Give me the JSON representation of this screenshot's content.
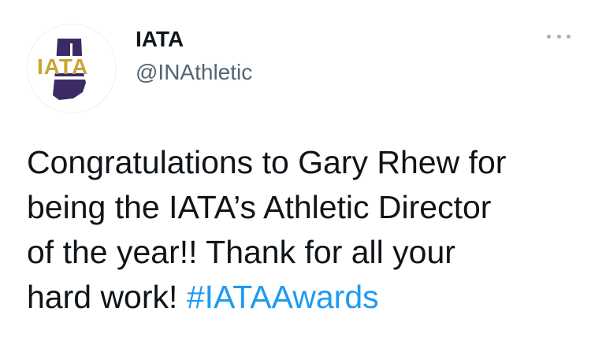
{
  "author": {
    "display_name": "IATA",
    "handle": "@INAthletic",
    "avatar_text": "IATA"
  },
  "tweet": {
    "lines": [
      "Congratulations to Gary Rhew for",
      "being the IATA’s Athletic Director",
      "of the year!! Thank for all your",
      "hard work! "
    ],
    "hashtag": "#IATAAwards"
  },
  "colors": {
    "text": "#0f1419",
    "handle": "#536471",
    "link": "#1d9bf0",
    "logo_gold": "#c7a536",
    "logo_purple": "#3b2a63"
  },
  "icons": {
    "more": "more-options-icon"
  }
}
